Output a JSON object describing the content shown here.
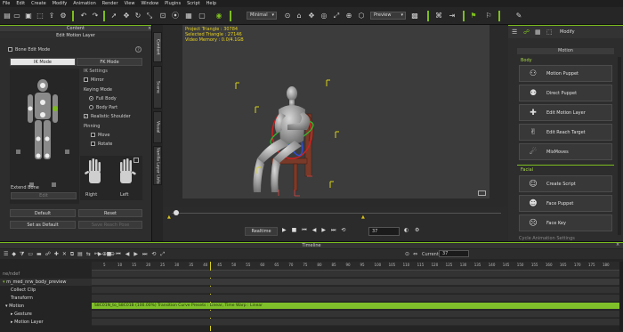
{
  "menubar": [
    "File",
    "Edit",
    "Create",
    "Modify",
    "Animation",
    "Render",
    "View",
    "Window",
    "Plugins",
    "Script",
    "Help"
  ],
  "toolbar": {
    "view_mode": "Minimal",
    "render_mode": "Preview"
  },
  "left_panel": {
    "title": "Content",
    "sub_title": "Edit Motion Layer",
    "bone_edit_mode": "Bone Edit Mode",
    "tabs": [
      "IK Mode",
      "FK Mode"
    ],
    "ik_settings_label": "IK Settings",
    "mirror": "Mirror",
    "keying_mode": "Keying Mode",
    "full_body": "Full Body",
    "body_part": "Body Part",
    "realistic_shoulder": "Realistic Shoulder",
    "pinning": "Pinning",
    "move": "Move",
    "rotate": "Rotate",
    "right": "Right",
    "left": "Left",
    "extend_bone": "Extend Bone",
    "edit": "Edit",
    "default_btn": "Default",
    "reset_btn": "Reset",
    "set_as_default": "Set as Default",
    "save_btn": "Save Reach Pose"
  },
  "left_tabs": [
    "Content",
    "Scene",
    "Visual",
    "Vanilla Layer Lists"
  ],
  "viewport": {
    "info": [
      "Project Triangle : 30784",
      "Selected Triangle : 27146",
      "Video Memory : 0.0/4.1GB"
    ]
  },
  "playbar": {
    "mode": "Realtime",
    "frame": "37"
  },
  "right_panel": {
    "title": "Modify",
    "section": "Motion",
    "body_label": "Body",
    "body_items": [
      "Motion Puppet",
      "Direct Puppet",
      "Edit Motion Layer",
      "Edit Reach Target",
      "MixMoves"
    ],
    "facial_label": "Facial",
    "facial_items": [
      "Create Script",
      "Face Puppet",
      "Face Key"
    ],
    "footer": "Cycle Animation Settings"
  },
  "timeline": {
    "title": "Timeline",
    "current_frame_label": "Current Frame :",
    "current_frame": "37",
    "rows": [
      "ne/ndef",
      "m_med_nrw_body_preview",
      "Collect Clip",
      "Transform",
      "Motion",
      "Gesture",
      "Motion Layer"
    ],
    "clip_text": "S8C01N_to_S8C01B (100.00%) Transition Curve Presets : Linear, Time Warp : Linear",
    "ticks": [
      "5",
      "10",
      "15",
      "20",
      "25",
      "30",
      "35",
      "40",
      "45",
      "50",
      "55",
      "60",
      "65",
      "70",
      "75",
      "80",
      "85",
      "90",
      "95",
      "100",
      "105",
      "110",
      "115",
      "120",
      "125",
      "130",
      "135",
      "140",
      "145",
      "150",
      "155",
      "160",
      "165",
      "170",
      "175",
      "180"
    ]
  },
  "colors": {
    "accent": "#7cbd1f",
    "info": "#e8d21f"
  }
}
